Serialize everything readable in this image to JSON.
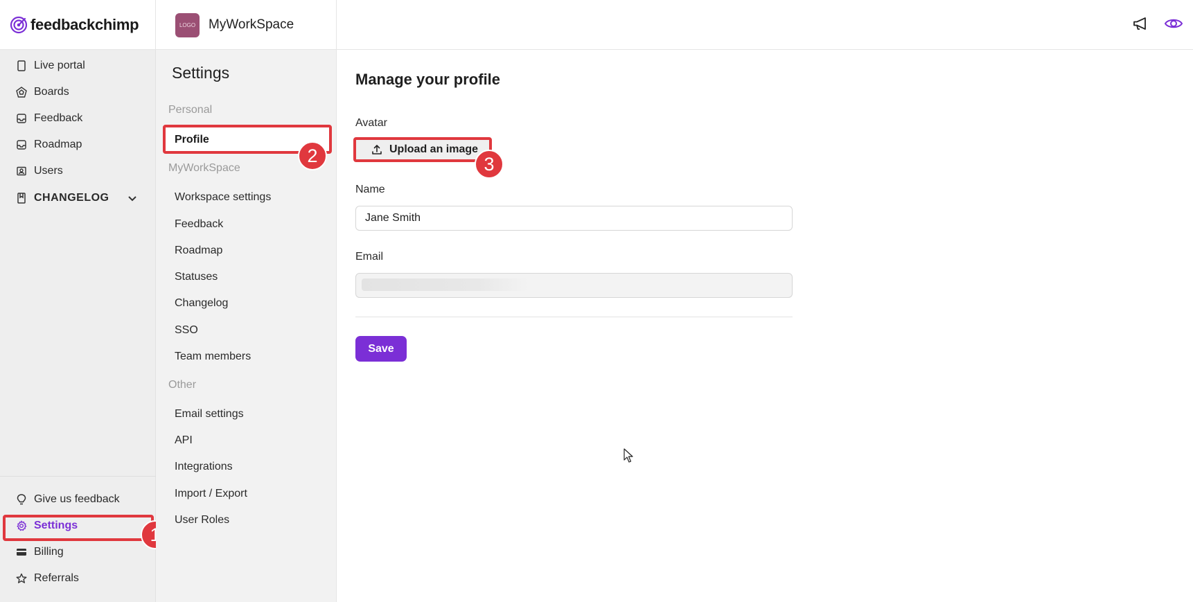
{
  "brand": {
    "name": "feedbackchimp"
  },
  "workspace": {
    "avatar_text": "LOGO",
    "name": "MyWorkSpace"
  },
  "topbar": {
    "icons": [
      "megaphone-icon",
      "eye-icon"
    ]
  },
  "sidebar": {
    "items": [
      {
        "label": "Live portal",
        "icon": "device-icon"
      },
      {
        "label": "Boards",
        "icon": "boards-icon"
      },
      {
        "label": "Feedback",
        "icon": "inbox-icon"
      },
      {
        "label": "Roadmap",
        "icon": "roadmap-icon"
      },
      {
        "label": "Users",
        "icon": "users-icon"
      },
      {
        "label": "CHANGELOG",
        "icon": "book-icon"
      }
    ],
    "bottom_items": [
      {
        "label": "Give us feedback",
        "icon": "lightbulb-icon"
      },
      {
        "label": "Settings",
        "icon": "gear-icon"
      },
      {
        "label": "Billing",
        "icon": "card-icon"
      },
      {
        "label": "Referrals",
        "icon": "star-icon"
      }
    ]
  },
  "settings": {
    "title": "Settings",
    "sections": [
      {
        "label": "Personal",
        "items": [
          "Profile"
        ]
      },
      {
        "label": "MyWorkSpace",
        "items": [
          "Workspace settings",
          "Feedback",
          "Roadmap",
          "Statuses",
          "Changelog",
          "SSO",
          "Team members"
        ]
      },
      {
        "label": "Other",
        "items": [
          "Email settings",
          "API",
          "Integrations",
          "Import / Export",
          "User Roles"
        ]
      }
    ]
  },
  "main": {
    "title": "Manage your profile",
    "avatar_label": "Avatar",
    "upload_label": "Upload an image",
    "name_label": "Name",
    "name_value": "Jane Smith",
    "email_label": "Email",
    "email_value": "",
    "save_label": "Save"
  },
  "callouts": [
    "1",
    "2",
    "3"
  ],
  "colors": {
    "accent": "#7b2fd6",
    "callout": "#e0383e"
  }
}
